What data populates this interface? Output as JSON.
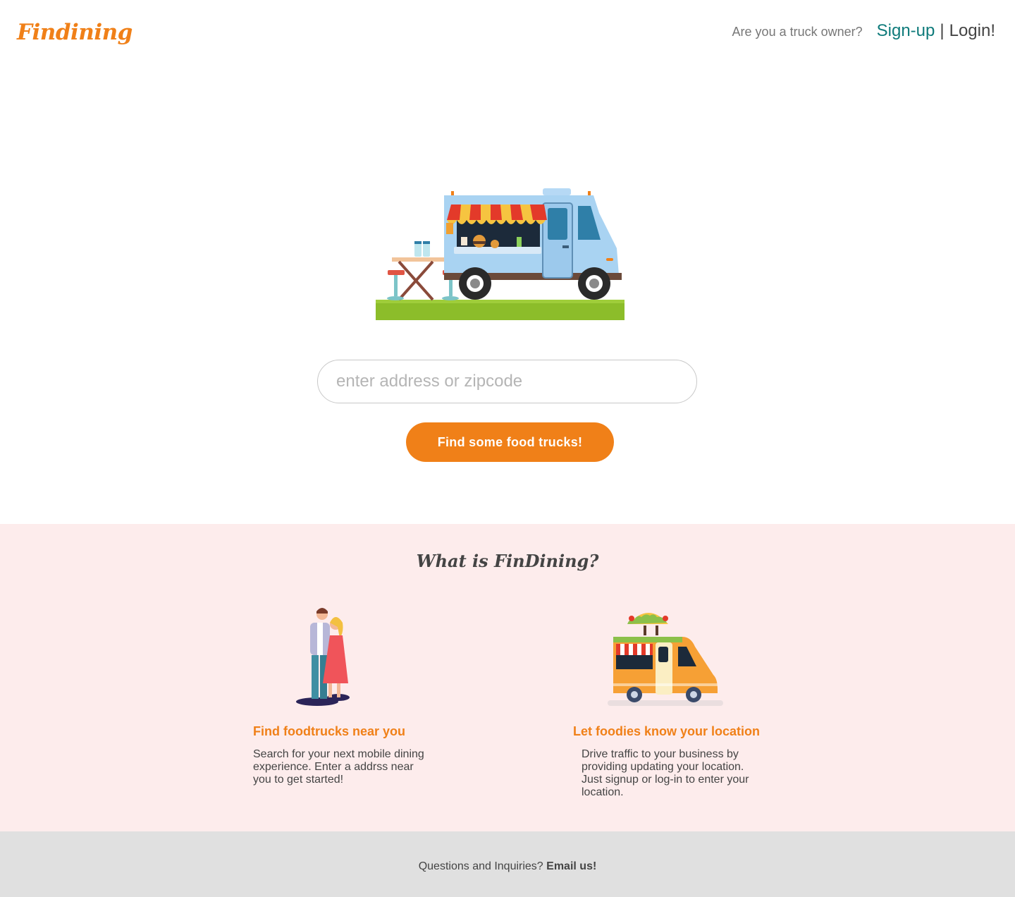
{
  "header": {
    "logo": "Findining",
    "owner_question": "Are you a truck owner?",
    "signup_label": "Sign-up",
    "separator": "|",
    "login_label": "Login!"
  },
  "hero": {
    "search_placeholder": "enter address or zipcode",
    "search_value": "",
    "find_button_label": "Find some food trucks!"
  },
  "about": {
    "title": "What is FinDining?",
    "features": [
      {
        "icon": "couple-illustration",
        "title": "Find foodtrucks near you",
        "description": "Search for your next mobile dining experience. Enter a addrss near you to get started!"
      },
      {
        "icon": "taco-truck-illustration",
        "title": "Let foodies know your location",
        "description": "Drive traffic to your business by providing updating your location. Just signup or log-in to enter your location."
      }
    ]
  },
  "footer": {
    "text": "Questions and Inquiries?",
    "email_label": "Email us!"
  },
  "colors": {
    "brand_orange": "#f08018",
    "teal_link": "#0f7b7b",
    "about_bg": "#fdecec",
    "footer_bg": "#e0e0e0"
  }
}
